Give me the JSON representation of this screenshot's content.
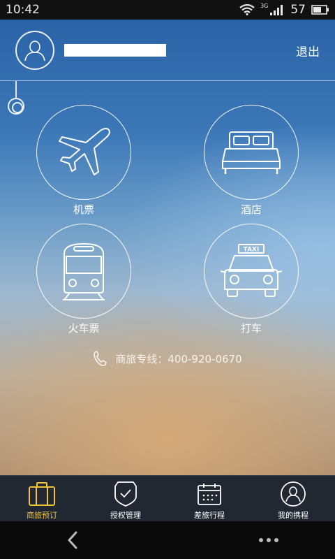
{
  "status_bar": {
    "time": "10:42",
    "network": "3G",
    "battery": "57",
    "icons": [
      "wifi-icon",
      "signal-icon",
      "battery-icon"
    ]
  },
  "header": {
    "logout_label": "退出",
    "avatar_icon": "user-avatar-icon"
  },
  "services": [
    {
      "label": "机票",
      "icon": "airplane-icon"
    },
    {
      "label": "酒店",
      "icon": "bed-icon"
    },
    {
      "label": "火车票",
      "icon": "train-icon"
    },
    {
      "label": "打车",
      "icon": "taxi-icon"
    }
  ],
  "taxi_sign": "TAXI",
  "hotline": {
    "text": "商旅专线：400-920-0670",
    "icon": "phone-icon"
  },
  "tabs": [
    {
      "label": "商旅预订",
      "icon": "briefcase-icon",
      "active": true
    },
    {
      "label": "授权管理",
      "icon": "shield-check-icon",
      "active": false
    },
    {
      "label": "差旅行程",
      "icon": "calendar-icon",
      "active": false
    },
    {
      "label": "我的携程",
      "icon": "user-circle-icon",
      "active": false
    }
  ],
  "colors": {
    "active_tab": "#f1c232",
    "tabbar_bg": "#222832",
    "sky_blue": "#2a63a6",
    "sand": "#a78b70"
  }
}
